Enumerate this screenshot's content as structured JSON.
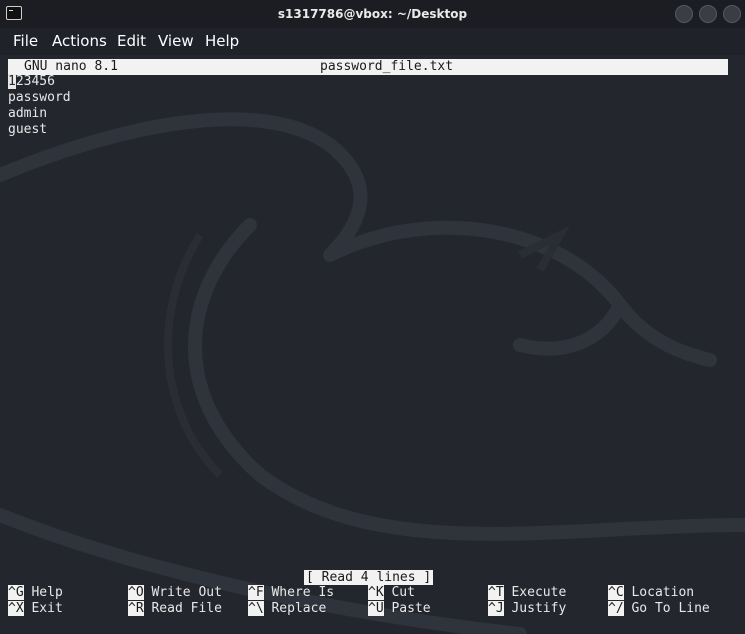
{
  "window": {
    "title": "s1317786@vbox: ~/Desktop"
  },
  "menubar": {
    "items": [
      "File",
      "Actions",
      "Edit",
      "View",
      "Help"
    ]
  },
  "nano": {
    "version": "GNU nano 8.1",
    "filename": "password_file.txt",
    "lines": [
      "123456",
      "password",
      "admin",
      "guest"
    ],
    "status": "[ Read 4 lines ]",
    "shortcuts": [
      {
        "key": "^G",
        "label": "Help"
      },
      {
        "key": "^O",
        "label": "Write Out"
      },
      {
        "key": "^F",
        "label": "Where Is"
      },
      {
        "key": "^K",
        "label": "Cut"
      },
      {
        "key": "^T",
        "label": "Execute"
      },
      {
        "key": "^C",
        "label": "Location"
      },
      {
        "key": "^X",
        "label": "Exit"
      },
      {
        "key": "^R",
        "label": "Read File"
      },
      {
        "key": "^\\",
        "label": "Replace"
      },
      {
        "key": "^U",
        "label": "Paste"
      },
      {
        "key": "^J",
        "label": "Justify"
      },
      {
        "key": "^/",
        "label": "Go To Line"
      }
    ]
  },
  "colors": {
    "background": "#23262d",
    "titlebar": "#1b1d22",
    "highlight": "#f2f2f2"
  }
}
